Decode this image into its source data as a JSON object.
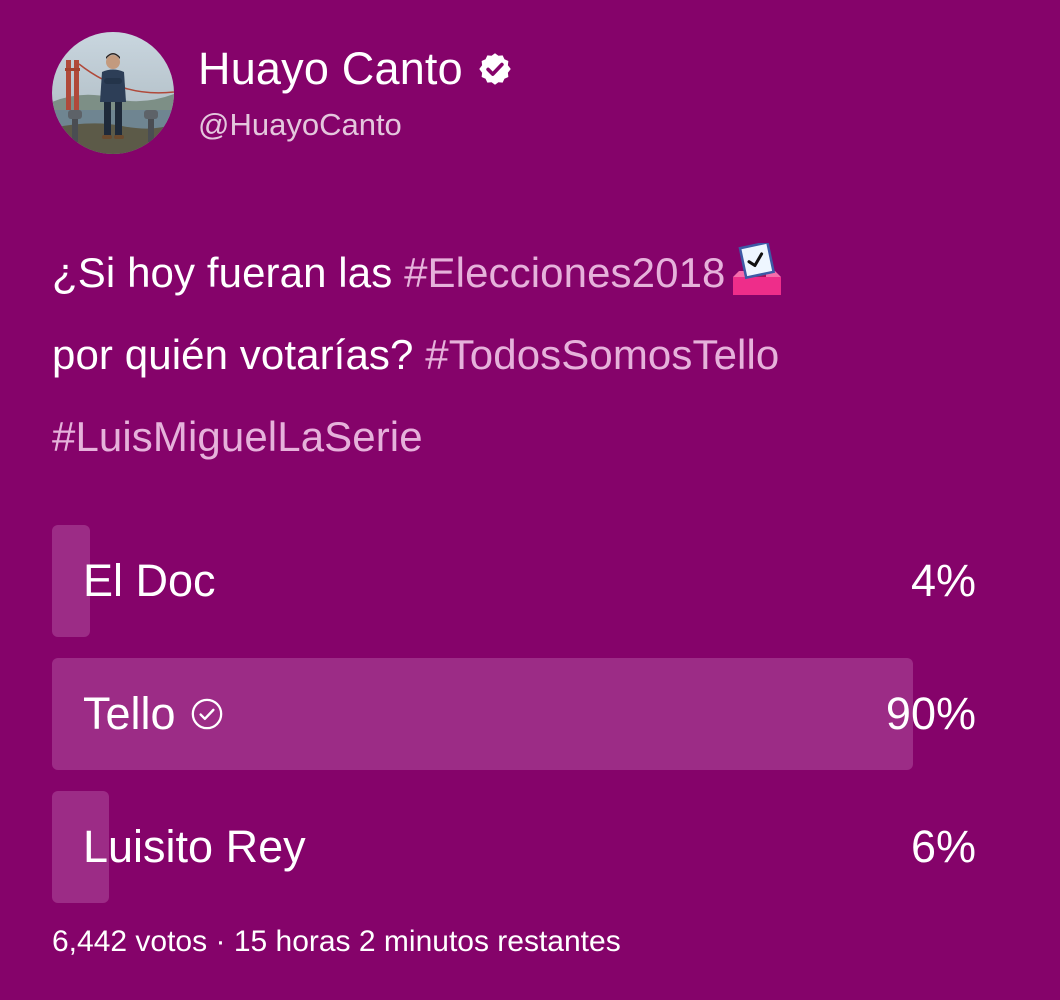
{
  "author": {
    "display_name": "Huayo Canto",
    "handle": "@HuayoCanto",
    "verified": true,
    "avatar": "profile-photo"
  },
  "tweet": {
    "segments": [
      {
        "text": "¿Si hoy fueran las ",
        "hashtag": false
      },
      {
        "text": "#Elecciones2018",
        "hashtag": true
      },
      {
        "emoji": "ballot-box-emoji"
      },
      {
        "text": " por quién votarías? ",
        "hashtag": false
      },
      {
        "text": "#TodosSomosTello",
        "hashtag": true
      },
      {
        "text": " ",
        "hashtag": false
      },
      {
        "text": "#LuisMiguelLaSerie",
        "hashtag": true
      }
    ]
  },
  "poll": {
    "options": [
      {
        "label": "El Doc",
        "percent_text": "4%",
        "percent": 4,
        "winner": false
      },
      {
        "label": "Tello",
        "percent_text": "90%",
        "percent": 90,
        "winner": true
      },
      {
        "label": "Luisito Rey",
        "percent_text": "6%",
        "percent": 6,
        "winner": false
      }
    ],
    "votes": "6,442 votos",
    "separator": "·",
    "time_left": "15 horas 2 minutos restantes"
  },
  "colors": {
    "background": "#85036a",
    "bar": "#9c2c86",
    "hashtag": "#e6b2db",
    "handle": "#e4c7dd",
    "text": "#ffffff"
  }
}
